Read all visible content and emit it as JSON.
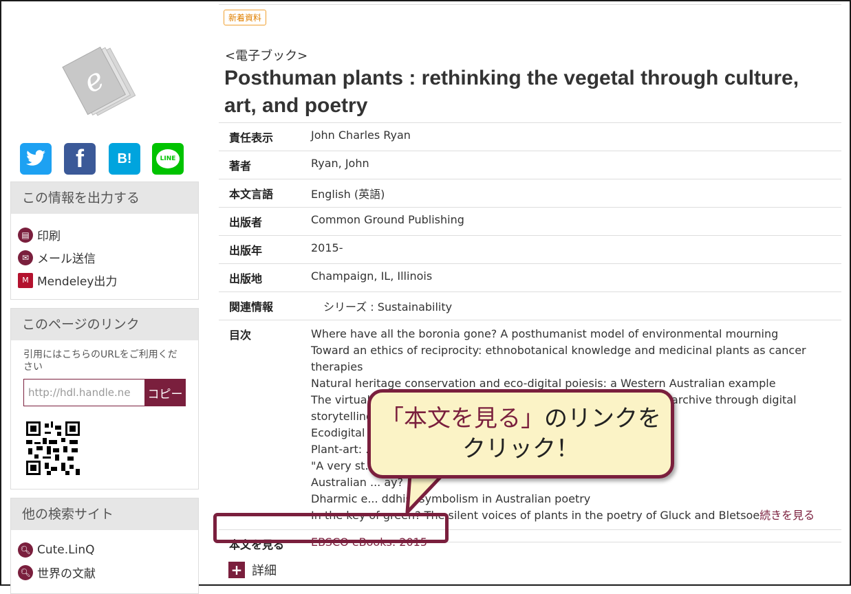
{
  "badge": "新着資料",
  "type_label": "<電子ブック>",
  "title": "Posthuman plants : rethinking the vegetal through culture, art, and poetry",
  "social": [
    {
      "name": "twitter-icon",
      "color": "#1da1f2",
      "glyph": "🐦"
    },
    {
      "name": "facebook-icon",
      "color": "#3b5998",
      "glyph": "f"
    },
    {
      "name": "hatena-bookmark-icon",
      "color": "#00a4de",
      "glyph": "B!"
    },
    {
      "name": "line-icon",
      "color": "#00c300",
      "glyph": "LINE"
    }
  ],
  "export_panel": {
    "title": "この情報を出力する",
    "items": [
      {
        "label": "印刷",
        "icon": "print-icon"
      },
      {
        "label": "メール送信",
        "icon": "mail-icon"
      },
      {
        "label": "Mendeley出力",
        "icon": "mendeley-icon"
      }
    ]
  },
  "link_panel": {
    "title": "このページのリンク",
    "note": "引用にはこちらのURLをご利用ください",
    "url": "http://hdl.handle.ne",
    "copy_label": "コピー"
  },
  "search_panel": {
    "title": "他の検索サイト",
    "items": [
      {
        "label": "Cute.LinQ",
        "icon": "search-icon"
      },
      {
        "label": "世界の文献",
        "icon": "search-icon"
      }
    ]
  },
  "meta": {
    "responsibility": {
      "key": "責任表示",
      "value": "John Charles Ryan"
    },
    "author": {
      "key": "著者",
      "value": "Ryan, John"
    },
    "language": {
      "key": "本文言語",
      "value": "English (英語)"
    },
    "publisher": {
      "key": "出版者",
      "value": "Common Ground Publishing"
    },
    "year": {
      "key": "出版年",
      "value": "2015-"
    },
    "place": {
      "key": "出版地",
      "value": "Champaign, IL, Illinois"
    },
    "related": {
      "key": "関連情報",
      "series_label": "シリーズ",
      "value": "Sustainability"
    },
    "toc": {
      "key": "目次",
      "lines": [
        "Where have all the boronia gone? A posthumanist model of environmental mourning",
        "Toward an ethics of reciprocity: ethnobotanical knowledge and medicinal plants as cancer therapies",
        "Natural heritage conservation and eco-digital poiesis: a Western Australian example",
        "The virtual and the vegetal: creating a living biocultural heritage archive through digital storytelling approaches",
        "Ecodigital ... rity",
        "Plant-art: ... nce and installation art",
        "\"A very st... stralian Christmas tree",
        "Australian ... ay?",
        "Dharmic e... ddhist symbolism in Australian poetry",
        "In the key of green? The silent voices of plants in the poetry of Gluck and Bletsoe"
      ],
      "more_label": "続きを見る"
    },
    "fulltext": {
      "key": "本文を見る",
      "value": "EBSCO eBooks: 2015"
    }
  },
  "detail_label": "詳細",
  "callout": {
    "emphasis": "「本文を見る」",
    "rest_line1": "のリンクを",
    "line2": "クリック！"
  }
}
